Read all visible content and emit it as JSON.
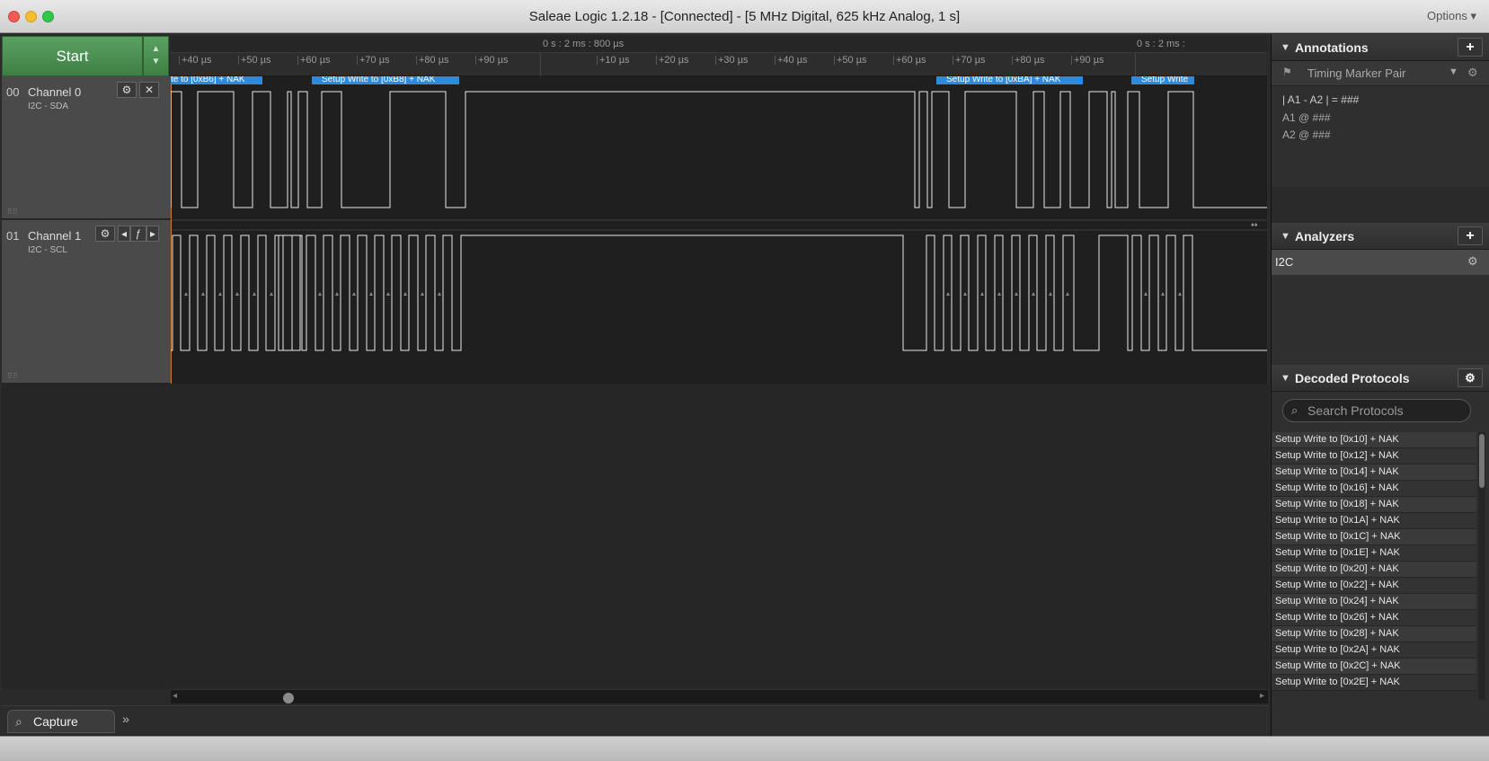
{
  "window": {
    "title": "Saleae Logic 1.2.18 - [Connected] - [5 MHz Digital, 625 kHz Analog, 1 s]",
    "options_label": "Options ▾"
  },
  "toolbar": {
    "start_label": "Start"
  },
  "ruler": {
    "top_center": "0 s : 2 ms : 800 µs",
    "top_right": "0 s : 2 ms :",
    "ticks": [
      "+40 µs",
      "+50 µs",
      "+60 µs",
      "+70 µs",
      "+80 µs",
      "+90 µs",
      "+10 µs",
      "+20 µs",
      "+30 µs",
      "+40 µs",
      "+50 µs",
      "+60 µs",
      "+70 µs",
      "+80 µs",
      "+90 µs"
    ]
  },
  "decode_bubbles": [
    "te to [0xB6] + NAK",
    "Setup Write to [0xB8] + NAK",
    "Setup Write to [0xBA] + NAK",
    "Setup Write"
  ],
  "channels": [
    {
      "num": "00",
      "name": "Channel 0",
      "sub": "I2C - SDA"
    },
    {
      "num": "01",
      "name": "Channel 1",
      "sub": "I2C - SCL"
    }
  ],
  "bottom": {
    "capture_tab": "Capture"
  },
  "annotations": {
    "header": "Annotations",
    "timing_marker": "Timing Marker Pair",
    "row1": "| A1 - A2 | = ###",
    "row2": "A1  @  ###",
    "row3": "A2  @  ###"
  },
  "analyzers": {
    "header": "Analyzers",
    "items": [
      "I2C"
    ]
  },
  "decoded": {
    "header": "Decoded Protocols",
    "search_placeholder": "Search Protocols",
    "items": [
      "Setup Write to [0x10] + NAK",
      "Setup Write to [0x12] + NAK",
      "Setup Write to [0x14] + NAK",
      "Setup Write to [0x16] + NAK",
      "Setup Write to [0x18] + NAK",
      "Setup Write to [0x1A] + NAK",
      "Setup Write to [0x1C] + NAK",
      "Setup Write to [0x1E] + NAK",
      "Setup Write to [0x20] + NAK",
      "Setup Write to [0x22] + NAK",
      "Setup Write to [0x24] + NAK",
      "Setup Write to [0x26] + NAK",
      "Setup Write to [0x28] + NAK",
      "Setup Write to [0x2A] + NAK",
      "Setup Write to [0x2C] + NAK",
      "Setup Write to [0x2E] + NAK"
    ]
  },
  "colors": {
    "accent_green": "#4a8f50",
    "decode_blue": "#2b8be0",
    "trace": "#e8e8e8",
    "marker_orange": "#d07a30"
  }
}
